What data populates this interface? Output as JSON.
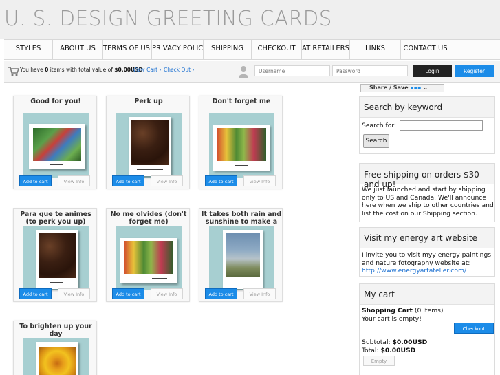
{
  "site": {
    "title": "U. S. DESIGN GREETING CARDS"
  },
  "nav": {
    "items": [
      "STYLES",
      "ABOUT US",
      "TERMS OF USE",
      "PRIVACY POLICY",
      "SHIPPING",
      "CHECKOUT",
      "AT RETAILERS",
      "LINKS",
      "CONTACT US"
    ]
  },
  "cart_bar": {
    "summary_prefix": "You have",
    "item_count": "0",
    "summary_mid": "items with total value of",
    "total": "$0.00USD",
    "view_cart": "View Cart",
    "check_out": "Check Out",
    "username_placeholder": "Username",
    "password_placeholder": "Password",
    "login": "Login",
    "register": "Register"
  },
  "products": [
    {
      "title": "Good for you!",
      "image": "flowers-photo"
    },
    {
      "title": "Perk up",
      "image": "coffee-beans-photo"
    },
    {
      "title": "Don't forget me",
      "image": "market-flowers-photo"
    },
    {
      "title": "Para que te animes (to perk you up)",
      "image": "coffee-beans-photo"
    },
    {
      "title": "No me olvides (don't forget me)",
      "image": "market-flowers-photo"
    },
    {
      "title": "It takes both rain and sunshine to make a rainbow",
      "image": "rainbow-photo"
    },
    {
      "title": "To brighten up your day",
      "image": "sunflower-photo"
    }
  ],
  "product_buttons": {
    "add_to_cart": "Add to cart",
    "view_info": "View Info"
  },
  "sidebar": {
    "share": "Share / Save",
    "search": {
      "title": "Search by keyword",
      "label": "Search for:",
      "button": "Search"
    },
    "shipping": {
      "title": "Free shipping on orders $30 and up!",
      "body": "We just launched and start by shipping only to US and Canada. We'll announce here when we ship to other countries and list the cost on our Shipping section."
    },
    "energy": {
      "title": "Visit my energy art website",
      "body": "I invite you to visit myy energy paintings and nature fotography website at:",
      "link": "http://www.energyartatelier.com/"
    },
    "cart": {
      "title": "My cart",
      "heading": "Shopping Cart",
      "items": "(0 Items)",
      "empty_msg": "Your cart is empty!",
      "checkout": "Checkout",
      "subtotal_label": "Subtotal:",
      "subtotal": "$0.00USD",
      "total_label": "Total:",
      "total": "$0.00USD",
      "empty_button": "Empty"
    }
  },
  "colors": {
    "accent_blue": "#1c8ce8",
    "thumb_bg": "#a7cfd1",
    "title_grey": "#9a9a9a"
  }
}
